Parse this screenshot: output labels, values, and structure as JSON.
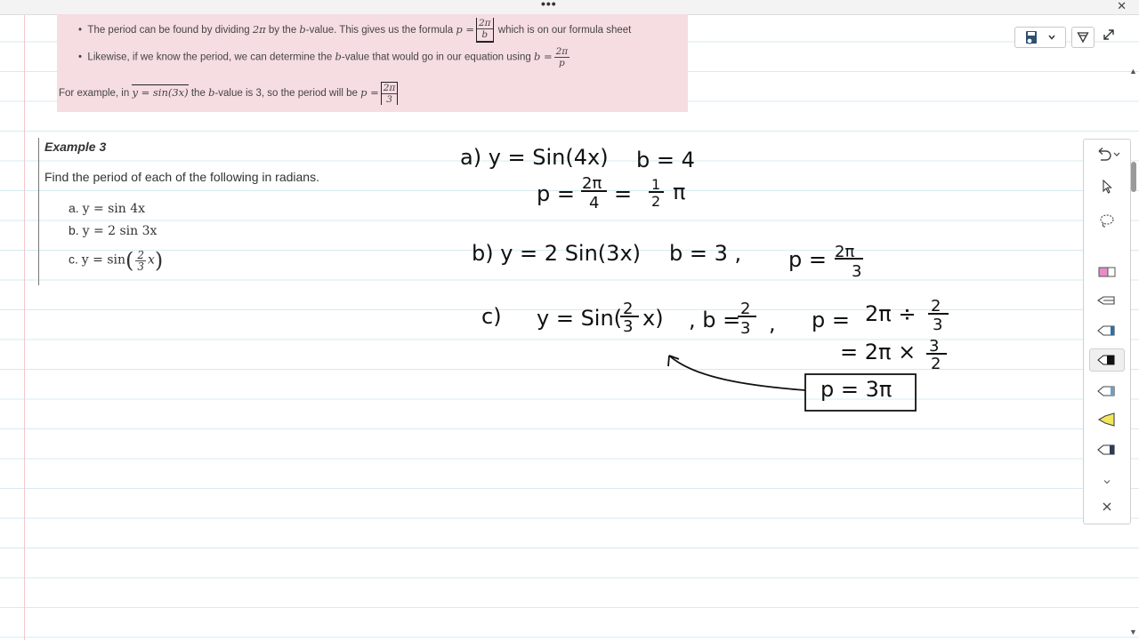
{
  "window": {
    "menu_dots": "•••",
    "close_glyph": "✕"
  },
  "notes": {
    "bullet1": {
      "before": "The period can be found by dividing ",
      "two_pi": "2π",
      "mid": " by the ",
      "b_var": "b",
      "after": "-value. This gives us the formula ",
      "formula_lhs": "p =",
      "formula_num": "2π",
      "formula_den": "b",
      "tail": " which is on our formula sheet"
    },
    "bullet2": {
      "before": "Likewise, if we know the period, we can determine the ",
      "b_var": "b",
      "after": "-value that would go in our equation using ",
      "formula_lhs": "b =",
      "formula_num": "2π",
      "formula_den": "p"
    },
    "example_line": {
      "before": "For example, in ",
      "eq": "y = sin(3x)",
      "mid": " the ",
      "b_var": "b",
      "after": "-value is 3, so the period will be ",
      "formula_lhs": "p =",
      "formula_num": "2π",
      "formula_den": "3"
    }
  },
  "example": {
    "title": "Example 3",
    "prompt": "Find the period of each of the following in radians.",
    "items": [
      {
        "label": "a.",
        "expr": "y = sin 4x"
      },
      {
        "label": "b.",
        "expr": "y = 2 sin 3x"
      },
      {
        "label": "c.",
        "expr": "y = sin",
        "frac_num": "2",
        "frac_den": "3",
        "suffix": "x"
      }
    ]
  },
  "handwriting": {
    "a_eq": "a) y = Sin(4x)",
    "a_b": "b = 4",
    "a_p": "p =",
    "a_frac_num": "2π",
    "a_frac_den": "4",
    "a_eq2": "=",
    "a_res_num": "1",
    "a_res_den": "2",
    "a_res_pi": "π",
    "b_eq": "b)  y = 2 Sin(3x)",
    "b_b": "b = 3 ,",
    "b_p": "p =",
    "b_frac_num": "2π",
    "b_frac_den": "3",
    "c_label": "c)",
    "c_eq": "y = Sin(",
    "c_frac_num": "2",
    "c_frac_den": "3",
    "c_eq_end": "x)",
    "c_b": ", b =",
    "c_b_num": "2",
    "c_b_den": "3",
    "c_comma": ",",
    "c_p": "p =",
    "c_step1": "2π ÷",
    "c_step1_num": "2",
    "c_step1_den": "3",
    "c_step2": "= 2π ×",
    "c_step2_num": "3",
    "c_step2_den": "2",
    "c_answer": "p = 3π"
  },
  "colors": {
    "note_background": "#f6dde2",
    "ruled_line": "#d6ebf1",
    "margin_line": "#f1c7cc",
    "ink": "#111111"
  },
  "toolbar": {
    "icons": [
      "save-icon",
      "chevron-down-icon",
      "funnel-icon",
      "expand-icon"
    ]
  },
  "pen_panel": {
    "tools": [
      "undo-icon",
      "pointer-icon",
      "lasso-icon",
      "eraser-icon",
      "highlighter-icon",
      "pen-icon",
      "pen-icon-black",
      "pen-icon-light",
      "highlighter-yellow-icon",
      "pen-icon-dark",
      "chevron-down-icon",
      "close-icon"
    ]
  }
}
